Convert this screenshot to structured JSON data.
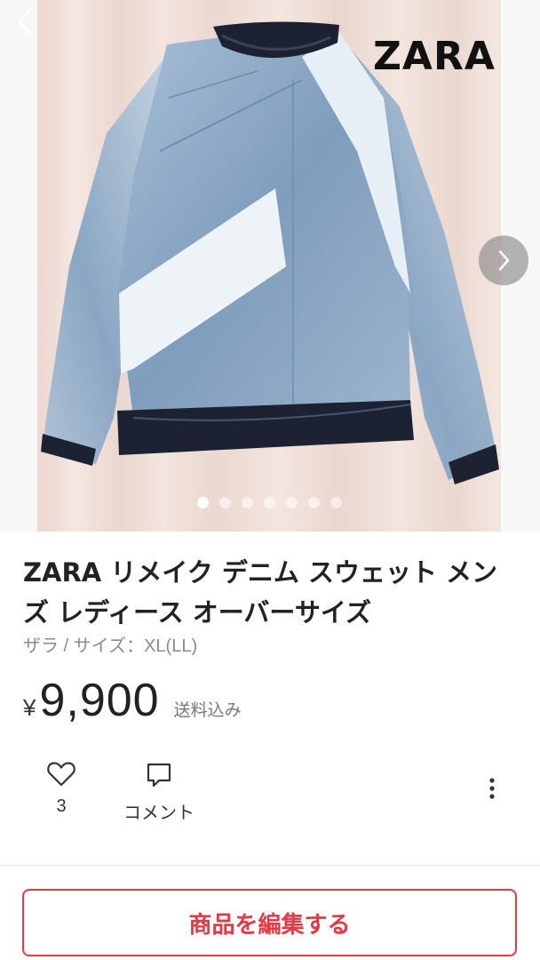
{
  "image": {
    "brand_logo": "ZARA",
    "dots_total": 7,
    "dots_active_index": 0
  },
  "product": {
    "title": "ZARA リメイク デニム スウェット メンズ レディース オーバーサイズ",
    "subtitle": "ザラ / サイズ：XL(LL)",
    "currency": "¥",
    "price": "9,900",
    "shipping": "送料込み"
  },
  "actions": {
    "like_count": "3",
    "comment_label": "コメント"
  },
  "footer": {
    "edit_button_label": "商品を編集する"
  },
  "colors": {
    "accent": "#e53945",
    "denim": "#8fa9c6",
    "background_curtain": "#efdfd8"
  },
  "icons": [
    "chevron-left-icon",
    "chevron-right-icon",
    "heart-icon",
    "comment-icon",
    "more-vertical-icon"
  ]
}
